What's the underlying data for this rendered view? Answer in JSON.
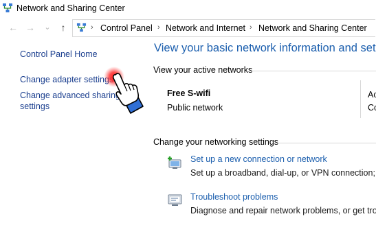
{
  "window": {
    "title": "Network and Sharing Center"
  },
  "navigation": {
    "back_glyph": "←",
    "forward_glyph": "→",
    "recent_glyph": "⌄",
    "up_glyph": "↑",
    "breadcrumb": [
      "Control Panel",
      "Network and Internet",
      "Network and Sharing Center"
    ],
    "separator_glyph": "›"
  },
  "sidebar": {
    "home": "Control Panel Home",
    "adapter": "Change adapter settings",
    "advanced_line1": "Change advanced sharing",
    "advanced_line2": "settings"
  },
  "main": {
    "heading": "View your basic network information and set u",
    "active_networks_label": "View your active networks",
    "network_name": "Free S-wifi",
    "network_type": "Public network",
    "access_clip1": "Ac",
    "access_clip2": "Co",
    "change_settings_label": "Change your networking settings",
    "tasks": [
      {
        "link": "Set up a new connection or network",
        "desc": "Set up a broadband, dial-up, or VPN connection; or"
      },
      {
        "link": "Troubleshoot problems",
        "desc": "Diagnose and repair network problems, or get troub"
      }
    ]
  },
  "colors": {
    "link": "#1c5fae",
    "sidebar_link": "#1b3f8f",
    "heading": "#1c5fae",
    "cursor_glow": "#ff2020"
  },
  "icons": {
    "title": "network-center-icon",
    "address": "control-panel-icon",
    "cursor": "hand-pointer-icon"
  }
}
